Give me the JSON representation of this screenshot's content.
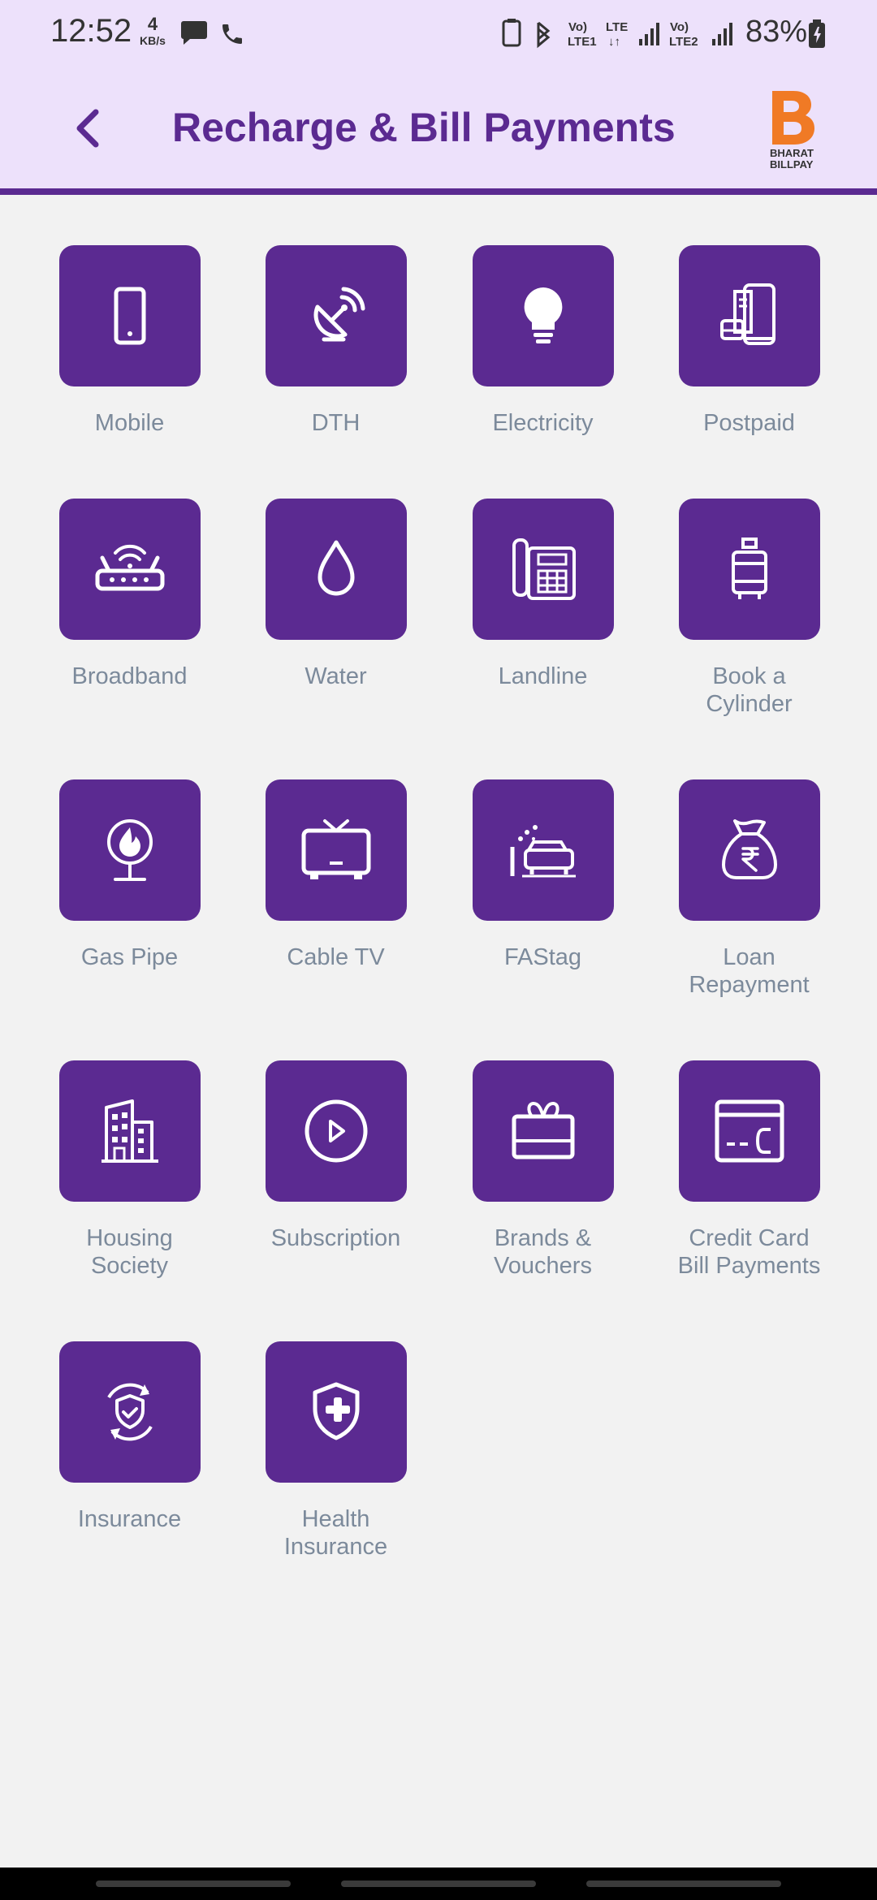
{
  "status_bar": {
    "time": "12:52",
    "speed_value": "4",
    "speed_unit": "KB/s",
    "battery": "83%"
  },
  "header": {
    "title": "Recharge & Bill Payments",
    "logo_text": "BHARAT BILLPAY"
  },
  "tiles": [
    {
      "label": "Mobile",
      "icon": "mobile-icon"
    },
    {
      "label": "DTH",
      "icon": "satellite-dish-icon"
    },
    {
      "label": "Electricity",
      "icon": "bulb-icon"
    },
    {
      "label": "Postpaid",
      "icon": "postpaid-icon"
    },
    {
      "label": "Broadband",
      "icon": "router-icon"
    },
    {
      "label": "Water",
      "icon": "water-drop-icon"
    },
    {
      "label": "Landline",
      "icon": "landline-icon"
    },
    {
      "label": "Book a\nCylinder",
      "icon": "gas-cylinder-icon"
    },
    {
      "label": "Gas Pipe",
      "icon": "gas-flame-icon"
    },
    {
      "label": "Cable TV",
      "icon": "tv-icon"
    },
    {
      "label": "FAStag",
      "icon": "car-icon"
    },
    {
      "label": "Loan\nRepayment",
      "icon": "money-bag-icon"
    },
    {
      "label": "Housing\nSociety",
      "icon": "building-icon"
    },
    {
      "label": "Subscription",
      "icon": "play-icon"
    },
    {
      "label": "Brands &\nVouchers",
      "icon": "gift-icon"
    },
    {
      "label": "Credit Card\nBill Payments",
      "icon": "credit-card-icon"
    },
    {
      "label": "Insurance",
      "icon": "insurance-shield-icon"
    },
    {
      "label": "Health\nInsurance",
      "icon": "health-shield-icon"
    }
  ],
  "colors": {
    "accent": "#5b2a91",
    "header_bg": "#ede1fb",
    "label": "#7c8a9b",
    "logo": "#f07a25"
  }
}
